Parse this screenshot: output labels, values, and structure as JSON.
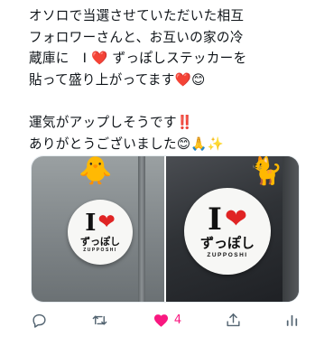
{
  "tweet": {
    "lines": [
      "オソロで当選させていただいた相互",
      "フォロワーさんと、お互いの家の冷",
      "蔵庫に　I ❤️ ずっぽしステッカーを",
      "貼って盛り上がってます❤️😊",
      "",
      "運気がアップしそうです‼️",
      "ありがとうございました😊🙏✨"
    ]
  },
  "media": {
    "left_photo": {
      "decoration": "🐥",
      "sticker": {
        "top_letter": "I",
        "heart": "❤",
        "jp_text": "ずっぽし",
        "en_text": "ZUPPOSHI"
      }
    },
    "right_photo": {
      "decoration": "🐈",
      "sticker": {
        "top_letter": "I",
        "heart": "❤",
        "jp_text": "ずっぽし",
        "en_text": "ZUPPOSHI"
      }
    }
  },
  "actions": {
    "like_count": "4"
  },
  "colors": {
    "text": "#0f1419",
    "icon": "#536471",
    "like": "#f91880",
    "heart": "#e02424"
  }
}
